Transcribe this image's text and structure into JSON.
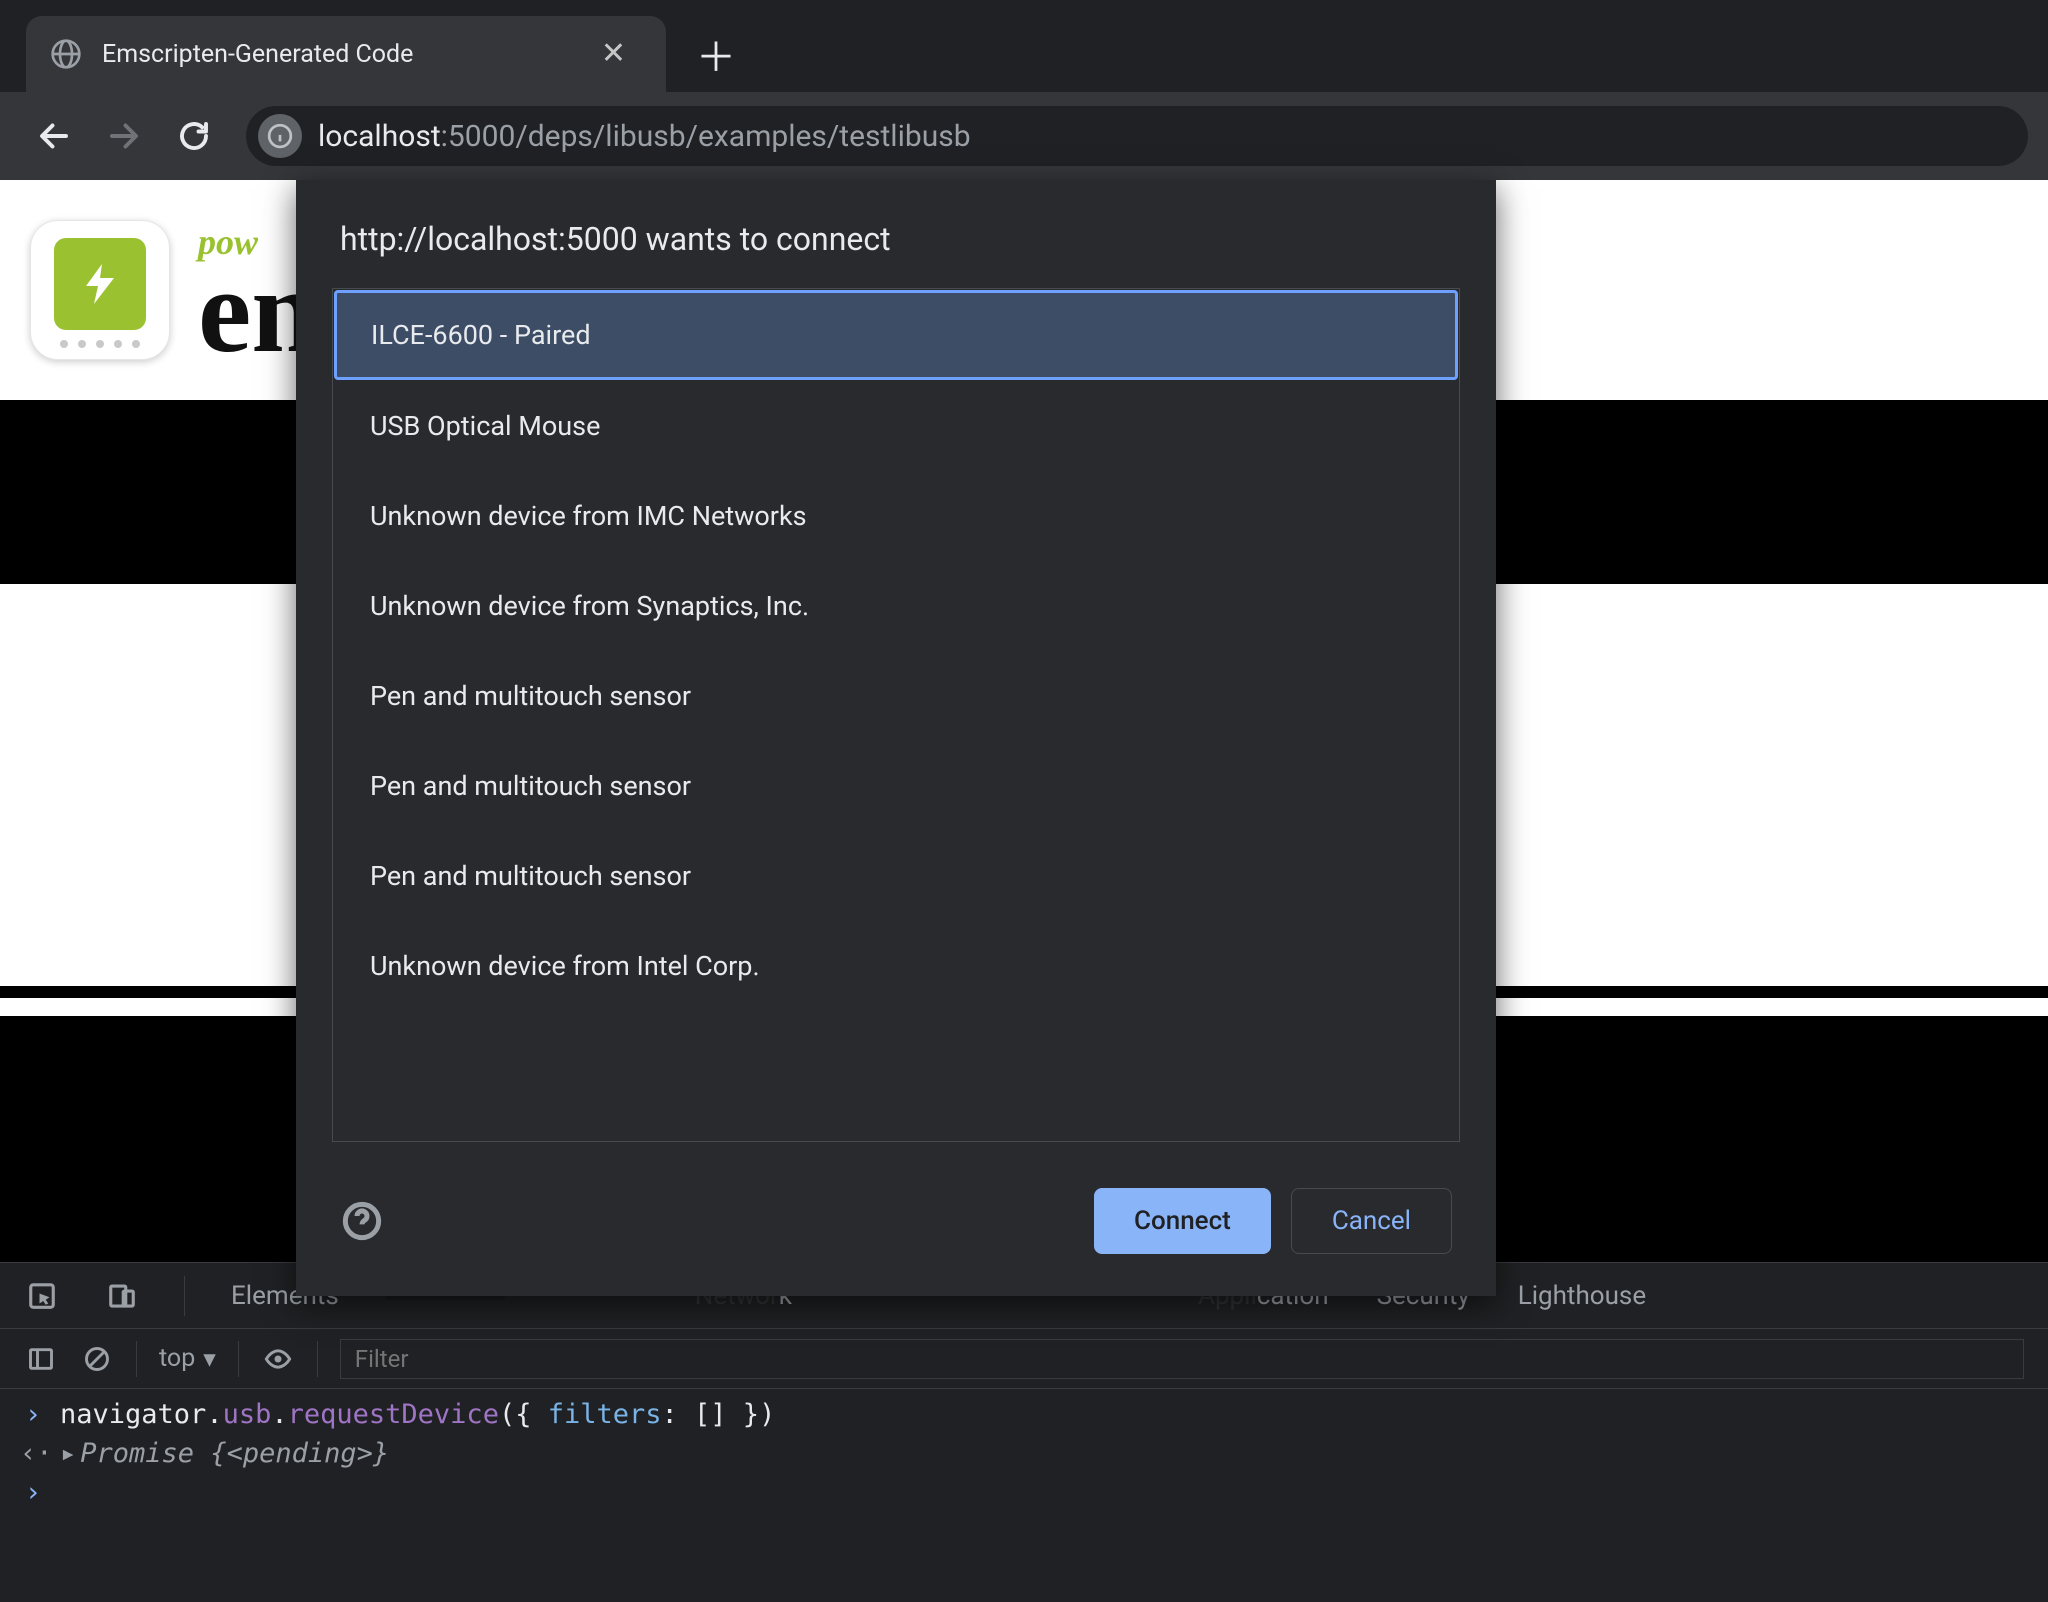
{
  "browser": {
    "tab_title": "Emscripten-Generated Code",
    "url_host": "localhost",
    "url_path": ":5000/deps/libusb/examples/testlibusb"
  },
  "page": {
    "brand_top": "pow",
    "brand_main": "en"
  },
  "dialog": {
    "title": "http://localhost:5000 wants to connect",
    "devices": [
      {
        "label": "ILCE-6600 - Paired",
        "selected": true
      },
      {
        "label": "USB Optical Mouse",
        "selected": false
      },
      {
        "label": "Unknown device from IMC Networks",
        "selected": false
      },
      {
        "label": "Unknown device from Synaptics, Inc.",
        "selected": false
      },
      {
        "label": "Pen and multitouch sensor",
        "selected": false
      },
      {
        "label": "Pen and multitouch sensor",
        "selected": false
      },
      {
        "label": "Pen and multitouch sensor",
        "selected": false
      },
      {
        "label": "Unknown device from Intel Corp.",
        "selected": false
      }
    ],
    "connect": "Connect",
    "cancel": "Cancel"
  },
  "devtools": {
    "tabs": {
      "elements": "Elements",
      "console_obscured_prefix": "",
      "sources_obscured": "",
      "network_obscured_suffix": "k",
      "perf_obscured": "",
      "memory_obscured": "",
      "application_obscured_suffix": "cation",
      "security": "Security",
      "lighthouse": "Lighthouse"
    },
    "context": "top",
    "filter_placeholder": "Filter",
    "line1": "navigator.usb.requestDevice({ filters: [] })",
    "line2_a": "Promise",
    "line2_b": "{",
    "line2_c": "<pending>",
    "line2_d": "}"
  }
}
